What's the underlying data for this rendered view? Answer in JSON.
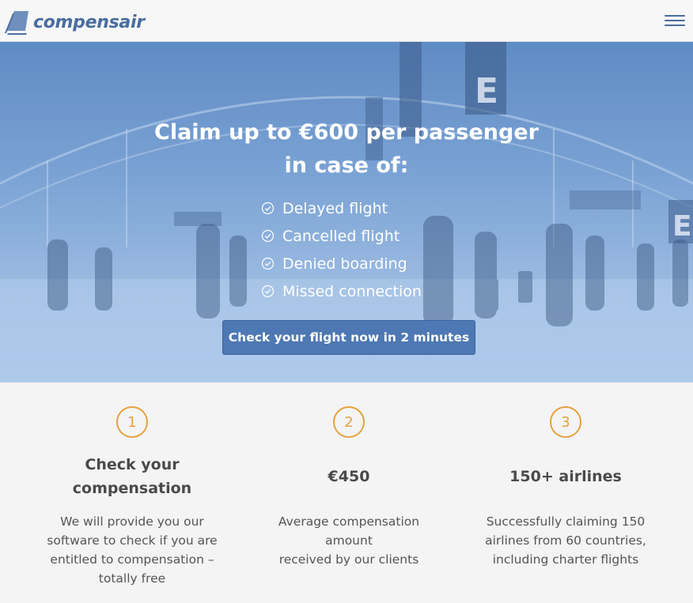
{
  "header": {
    "brand_name": "compensair",
    "logo_icon": "airplane-tail-logo",
    "menu_icon": "hamburger-menu-icon",
    "brand_color": "#4a6d9f"
  },
  "hero": {
    "title_line1": "Claim up to €600 per passenger",
    "title_line2": "in case of:",
    "reasons": [
      "Delayed flight",
      "Cancelled flight",
      "Denied boarding",
      "Missed connection"
    ],
    "cta_label": "Check your flight now in 2 minutes",
    "cta_color": "#4d78b3"
  },
  "features": [
    {
      "number": "1",
      "title_line1": "Check your",
      "title_line2": "compensation",
      "desc": [
        "We will provide you our",
        "software to check if you are",
        "entitled to compensation –",
        "totally free"
      ]
    },
    {
      "number": "2",
      "title_line1": "€450",
      "title_line2": "",
      "desc": [
        "Average compensation amount",
        "received by our clients"
      ]
    },
    {
      "number": "3",
      "title_line1": "150+ airlines",
      "title_line2": "",
      "desc": [
        "Successfully claiming 150",
        "airlines from 60 countries,",
        "including charter flights"
      ]
    }
  ],
  "accent_color": "#e4a23c"
}
